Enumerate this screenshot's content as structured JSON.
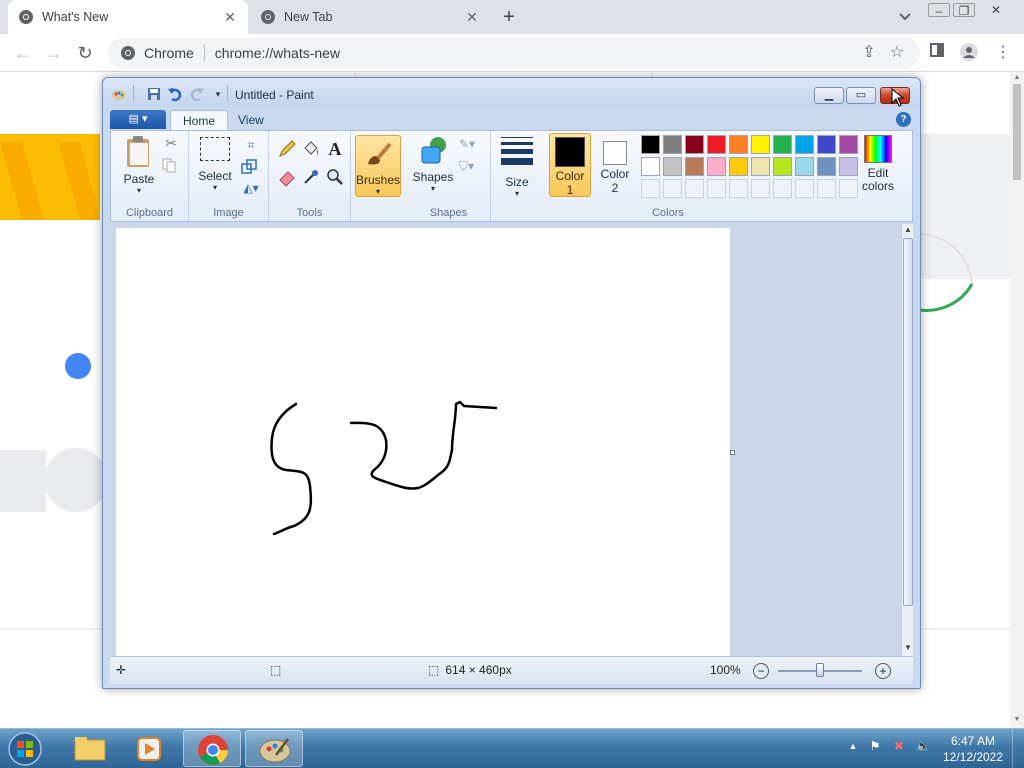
{
  "browser": {
    "tabs": [
      {
        "title": "What's New",
        "active": true
      },
      {
        "title": "New Tab",
        "active": false
      }
    ],
    "omnibox": {
      "site": "Chrome",
      "url": "chrome://whats-new"
    }
  },
  "paint": {
    "title": "Untitled - Paint",
    "ribbon_tabs": [
      "Home",
      "View"
    ],
    "groups": {
      "clipboard": {
        "label": "Clipboard",
        "paste": "Paste"
      },
      "image": {
        "label": "Image",
        "select": "Select"
      },
      "tools": {
        "label": "Tools"
      },
      "brushes": {
        "label": "Brushes"
      },
      "shapes": {
        "label": "Shapes",
        "shapes": "Shapes"
      },
      "size": {
        "label": "Size"
      },
      "colors": {
        "label": "Colors",
        "color1_a": "Color",
        "color1_b": "1",
        "color2_a": "Color",
        "color2_b": "2",
        "edit_a": "Edit",
        "edit_b": "colors"
      }
    },
    "palette_row1": [
      "#000000",
      "#7f7f7f",
      "#880015",
      "#ed1c24",
      "#ff7f27",
      "#fff200",
      "#22b14c",
      "#00a2e8",
      "#3f48cc",
      "#a349a4"
    ],
    "palette_row2": [
      "#ffffff",
      "#c3c3c3",
      "#b97a57",
      "#ffaec9",
      "#ffc90e",
      "#efe4b0",
      "#b5e61d",
      "#99d9ea",
      "#7092be",
      "#c8bfe7"
    ],
    "color1": "#000000",
    "color2": "#ffffff",
    "status": {
      "size": "614 × 460px",
      "zoom": "100%"
    }
  },
  "taskbar": {
    "time": "6:47 AM",
    "date": "12/12/2022"
  }
}
